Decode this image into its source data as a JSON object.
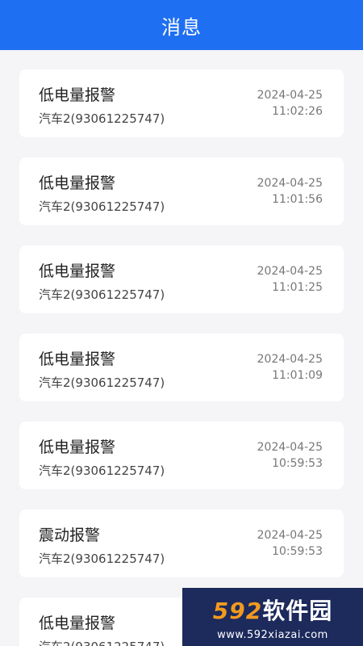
{
  "header": {
    "title": "消息"
  },
  "messages": [
    {
      "name": "低电量报警",
      "device": "汽车2(93061225747)",
      "date": "2024-04-25",
      "time": "11:02:26"
    },
    {
      "name": "低电量报警",
      "device": "汽车2(93061225747)",
      "date": "2024-04-25",
      "time": "11:01:56"
    },
    {
      "name": "低电量报警",
      "device": "汽车2(93061225747)",
      "date": "2024-04-25",
      "time": "11:01:25"
    },
    {
      "name": "低电量报警",
      "device": "汽车2(93061225747)",
      "date": "2024-04-25",
      "time": "11:01:09"
    },
    {
      "name": "低电量报警",
      "device": "汽车2(93061225747)",
      "date": "2024-04-25",
      "time": "10:59:53"
    },
    {
      "name": "震动报警",
      "device": "汽车2(93061225747)",
      "date": "2024-04-25",
      "time": "10:59:53"
    },
    {
      "name": "低电量报警",
      "device": "汽车2(93061225747)",
      "date": "",
      "time": ""
    }
  ],
  "watermark": {
    "brand_num": "592",
    "brand_text": "软件园",
    "url": "www.592xiazai.com"
  },
  "colors": {
    "header": "#1f6ff2",
    "background": "#f5f5f7",
    "card": "#ffffff"
  }
}
